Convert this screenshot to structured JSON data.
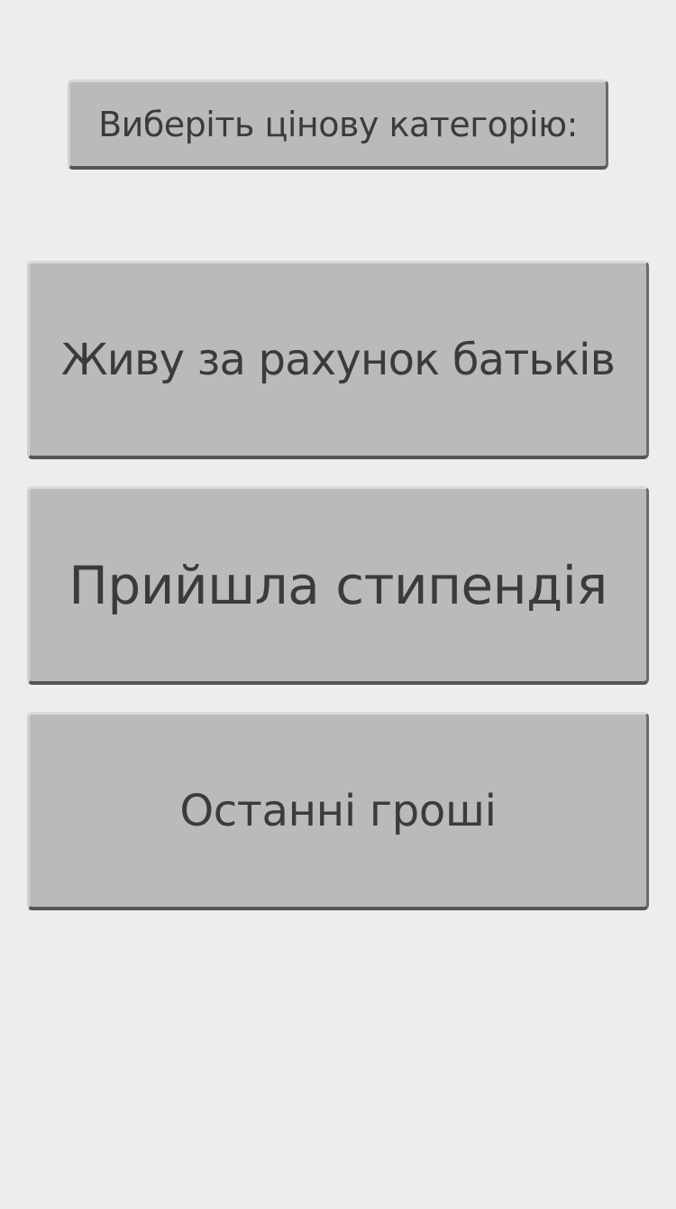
{
  "header": {
    "prompt_label": "Виберіть цінову категорію:"
  },
  "categories": [
    {
      "label": "Живу за рахунок батьків"
    },
    {
      "label": "Прийшла стипендія"
    },
    {
      "label": "Останні гроші"
    }
  ],
  "colors": {
    "background": "#ededed",
    "button_fill": "#bababa",
    "button_text": "#3b3b3b"
  }
}
